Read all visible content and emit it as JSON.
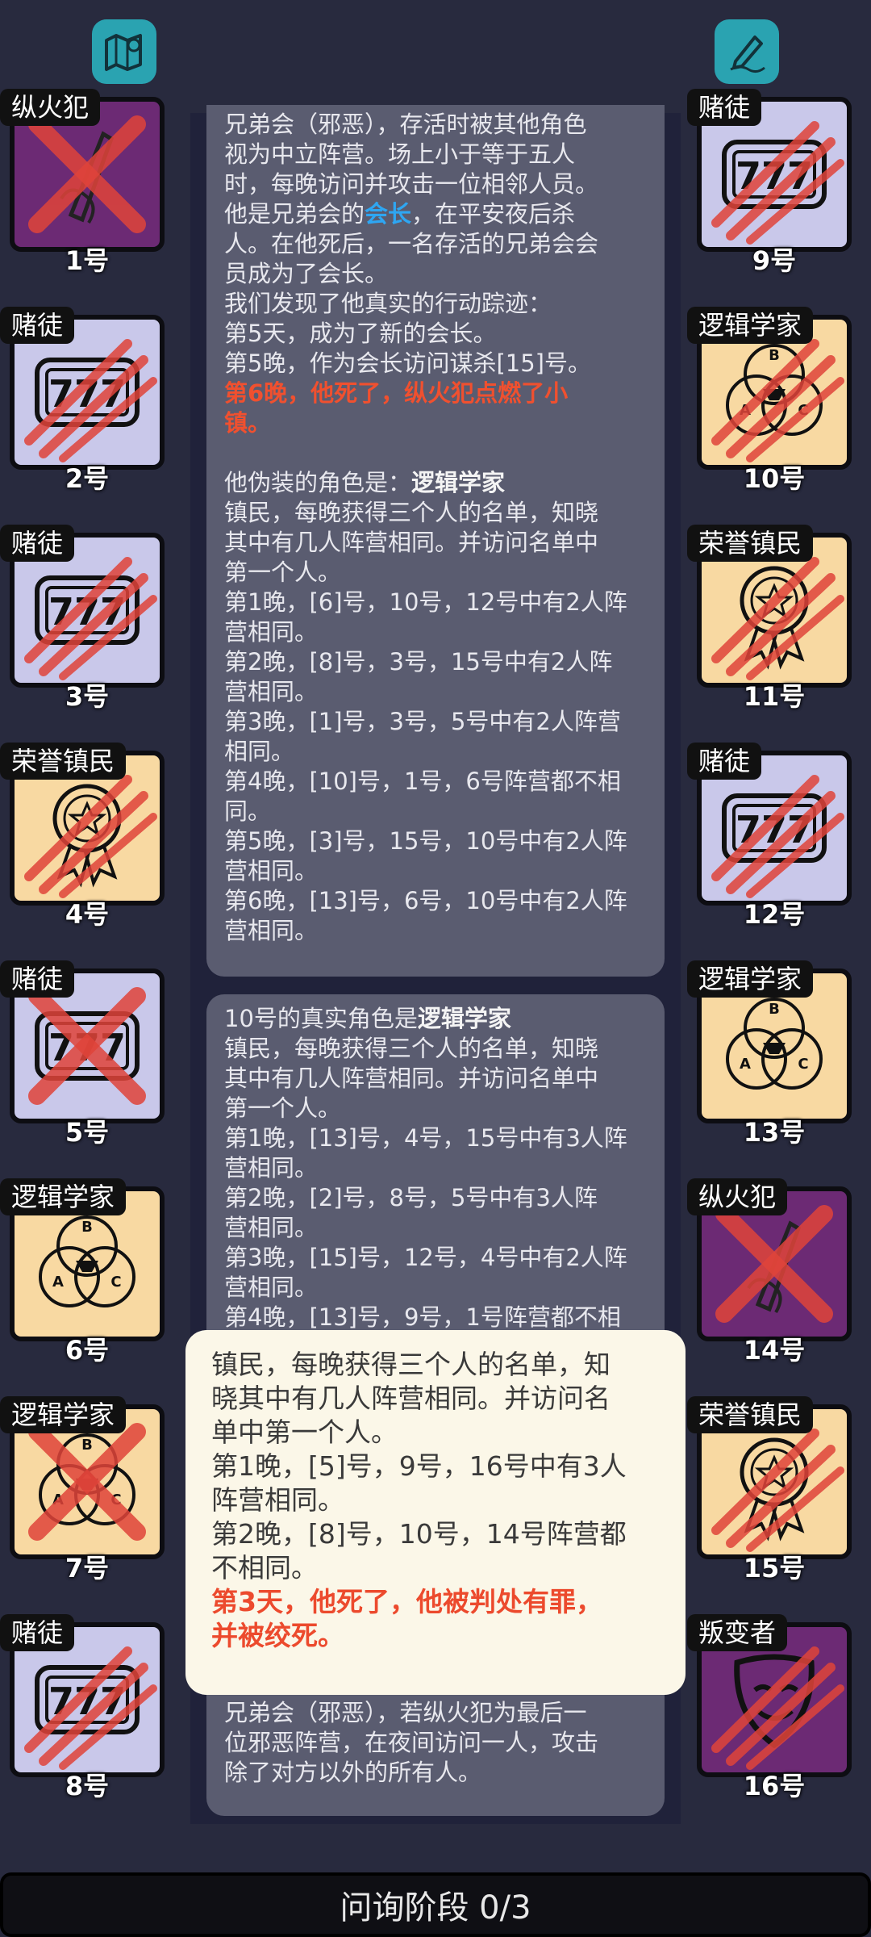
{
  "top": {
    "map_icon": "map-icon",
    "notes_icon": "edit-icon"
  },
  "players": [
    {
      "num": "1号",
      "role": "纵火犯",
      "type": "evil",
      "art": "knife",
      "mark": "x"
    },
    {
      "num": "2号",
      "role": "赌徒",
      "type": "gamb",
      "art": "slot",
      "mark": "claw"
    },
    {
      "num": "3号",
      "role": "赌徒",
      "type": "gamb",
      "art": "slot",
      "mark": "claw"
    },
    {
      "num": "4号",
      "role": "荣誉镇民",
      "type": "town",
      "art": "medal",
      "mark": "claw"
    },
    {
      "num": "5号",
      "role": "赌徒",
      "type": "gamb",
      "art": "slot",
      "mark": "x"
    },
    {
      "num": "6号",
      "role": "逻辑学家",
      "type": "town",
      "art": "venn",
      "mark": "none"
    },
    {
      "num": "7号",
      "role": "逻辑学家",
      "type": "town",
      "art": "venn",
      "mark": "x"
    },
    {
      "num": "8号",
      "role": "赌徒",
      "type": "gamb",
      "art": "slot",
      "mark": "claw"
    },
    {
      "num": "9号",
      "role": "赌徒",
      "type": "gamb",
      "art": "slot",
      "mark": "claw"
    },
    {
      "num": "10号",
      "role": "逻辑学家",
      "type": "town",
      "art": "venn",
      "mark": "claw"
    },
    {
      "num": "11号",
      "role": "荣誉镇民",
      "type": "town",
      "art": "medal",
      "mark": "claw"
    },
    {
      "num": "12号",
      "role": "赌徒",
      "type": "gamb",
      "art": "slot",
      "mark": "claw"
    },
    {
      "num": "13号",
      "role": "逻辑学家",
      "type": "town",
      "art": "venn",
      "mark": "none"
    },
    {
      "num": "14号",
      "role": "纵火犯",
      "type": "evil",
      "art": "knife",
      "mark": "x"
    },
    {
      "num": "15号",
      "role": "荣誉镇民",
      "type": "town",
      "art": "medal",
      "mark": "claw"
    },
    {
      "num": "16号",
      "role": "叛变者",
      "type": "evil",
      "art": "mask",
      "mark": "claw"
    }
  ],
  "bubble1": {
    "l1": "兄弟会（邪恶），存活时被其他角色",
    "l2": "视为中立阵营。场上小于等于五人",
    "l3": "时，每晚访问并攻击一位相邻人员。",
    "l4a": "他是兄弟会的",
    "l4b": "会长",
    "l4c": "，在平安夜后杀",
    "l5": "人。在他死后，一名存活的兄弟会会",
    "l6": "员成为了会长。",
    "l7": "我们发现了他真实的行动踪迹：",
    "l8": "第5天，成为了新的会长。",
    "l9": "第5晚，作为会长访问谋杀[15]号。",
    "l10": "第6晚，他死了，纵火犯点燃了小",
    "l11": "镇。",
    "l12a": "他伪装的角色是：",
    "l12b": "逻辑学家",
    "l13": "镇民，每晚获得三个人的名单，知晓",
    "l14": "其中有几人阵营相同。并访问名单中",
    "l15": "第一个人。",
    "l16": "第1晚，[6]号，10号，12号中有2人阵",
    "l17": "营相同。",
    "l18": "第2晚，[8]号，3号，15号中有2人阵",
    "l19": "营相同。",
    "l20": "第3晚，[1]号，3号，5号中有2人阵营",
    "l21": "相同。",
    "l22": "第4晚，[10]号，1号，6号阵营都不相",
    "l23": "同。",
    "l24": "第5晚，[3]号，15号，10号中有2人阵",
    "l25": "营相同。",
    "l26": "第6晚，[13]号，6号，10号中有2人阵",
    "l27": "营相同。"
  },
  "bubble2": {
    "l1a": "10号的真实角色是",
    "l1b": "逻辑学家",
    "l2": "镇民，每晚获得三个人的名单，知晓",
    "l3": "其中有几人阵营相同。并访问名单中",
    "l4": "第一个人。",
    "l5": "第1晚，[13]号，4号，15号中有3人阵",
    "l6": "营相同。",
    "l7": "第2晚，[2]号，8号，5号中有3人阵",
    "l8": "营相同。",
    "l9": "第3晚，[15]号，12号，4号中有2人阵",
    "l10": "营相同。",
    "l11": "第4晚，[13]号，9号，1号阵营都不相",
    "l12": "兄弟会（邪恶），若纵火犯为最后一",
    "l13": "位邪恶阵营，在夜间访问一人，攻击",
    "l14": "除了对方以外的所有人。"
  },
  "tooltip": {
    "l1": "镇民，每晚获得三个人的名单，知",
    "l2": "晓其中有几人阵营相同。并访问名",
    "l3": "单中第一个人。",
    "l4": "第1晚，[5]号，9号，16号中有3人",
    "l5": "阵营相同。",
    "l6": "第2晚，[8]号，10号，14号阵营都",
    "l7": "不相同。",
    "l8": "第3天，他死了，他被判处有罪，",
    "l9": "并被绞死。"
  },
  "bottom": {
    "phase": "问询阶段 0/3"
  },
  "colors": {
    "background": "#282a3e",
    "bubble": "#5a5c70",
    "accent_red": "#f0502f",
    "accent_blue": "#2ea6f2",
    "tooltip_bg": "#fbf7e8"
  }
}
